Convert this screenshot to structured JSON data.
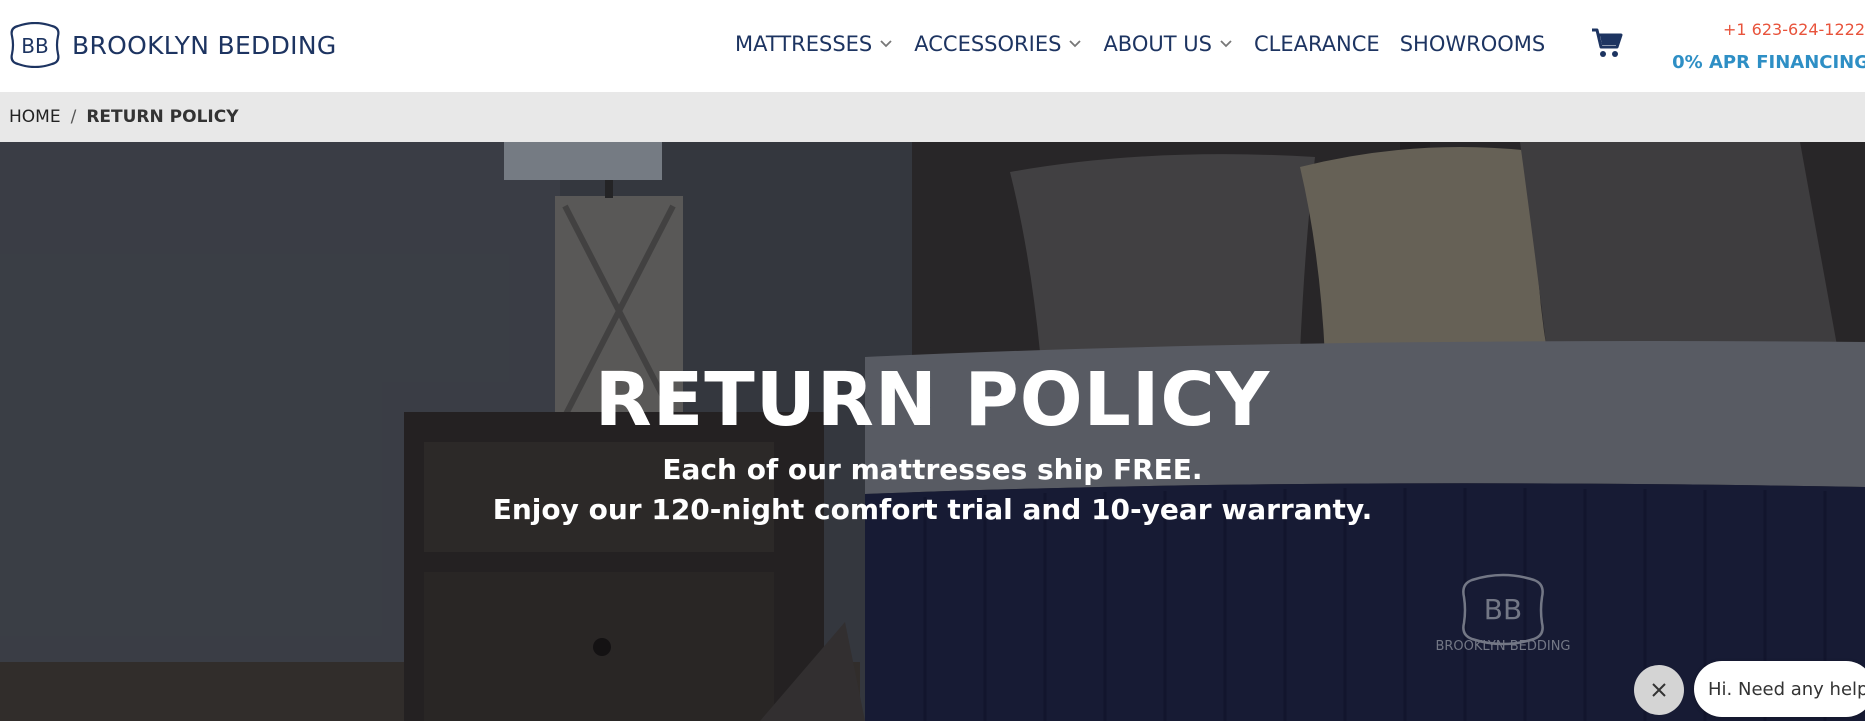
{
  "brand": {
    "name": "BROOKLYN BEDDING",
    "logo_mark": "BB"
  },
  "nav": {
    "items": [
      {
        "label": "MATTRESSES",
        "has_dropdown": true
      },
      {
        "label": "ACCESSORIES",
        "has_dropdown": true
      },
      {
        "label": "ABOUT US",
        "has_dropdown": true
      },
      {
        "label": "CLEARANCE",
        "has_dropdown": false
      },
      {
        "label": "SHOWROOMS",
        "has_dropdown": false
      }
    ],
    "cart_icon": "cart-icon"
  },
  "contact": {
    "phone": "+1 623-624-1222",
    "financing": "0% APR FINANCING"
  },
  "breadcrumb": {
    "home": "HOME",
    "separator": "/",
    "current": "RETURN POLICY"
  },
  "hero": {
    "title": "RETURN POLICY",
    "line1": "Each of our mattresses ship FREE.",
    "line2": "Enjoy our 120-night comfort trial and 10-year warranty.",
    "mattress_brand": "BROOKLYN BEDDING",
    "mattress_logo": "BB"
  },
  "chat": {
    "prompt": "Hi. Need any help?",
    "close_icon": "close-icon"
  },
  "colors": {
    "navy": "#1d3461",
    "phone": "#e8533b",
    "financing": "#2e8fc5",
    "breadcrumb_bg": "#e8e8e8"
  }
}
